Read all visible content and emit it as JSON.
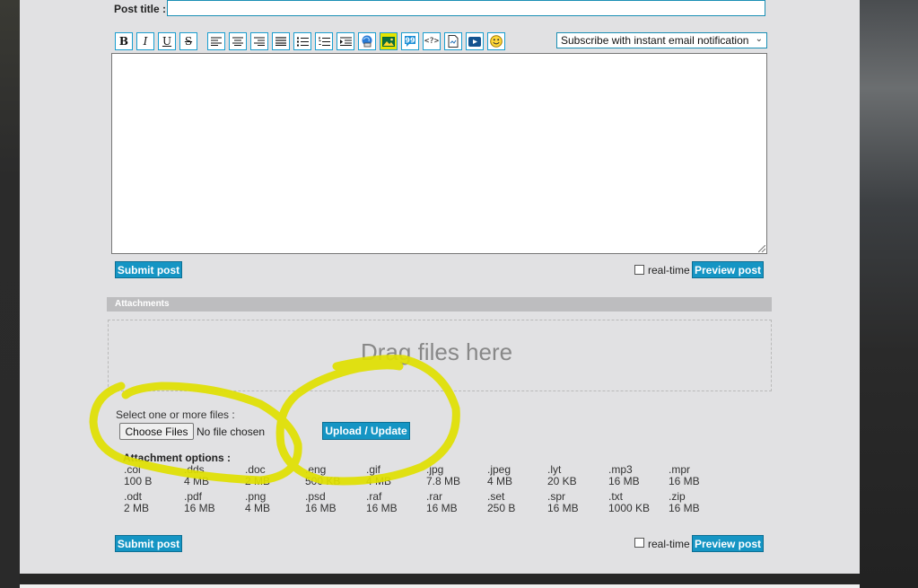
{
  "form": {
    "post_title_label": "Post title :",
    "post_title_value": ""
  },
  "toolbar": {
    "buttons": [
      {
        "name": "bold-icon",
        "glyph": "B"
      },
      {
        "name": "italic-icon",
        "glyph": "I"
      },
      {
        "name": "underline-icon",
        "glyph": "U"
      },
      {
        "name": "strikethrough-icon",
        "glyph": "S"
      },
      {
        "name": "align-left-icon"
      },
      {
        "name": "align-center-icon"
      },
      {
        "name": "align-right-icon"
      },
      {
        "name": "align-justify-icon"
      },
      {
        "name": "bulleted-list-icon"
      },
      {
        "name": "numbered-list-icon"
      },
      {
        "name": "indent-icon"
      },
      {
        "name": "insert-link-icon"
      },
      {
        "name": "insert-image-icon"
      },
      {
        "name": "quote-icon"
      },
      {
        "name": "code-icon",
        "glyph": "<?>"
      },
      {
        "name": "spoiler-icon"
      },
      {
        "name": "video-icon"
      },
      {
        "name": "smiley-icon"
      }
    ],
    "highlight_color": "#e4e400",
    "border_color": "#1a9ed0"
  },
  "subscribe": {
    "selected": "Subscribe with instant email notification"
  },
  "actions": {
    "submit_label": "Submit post",
    "realtime_label": "real-time",
    "preview_label": "Preview post",
    "accent": "#1595c4"
  },
  "attachments": {
    "header": "Attachments",
    "drag_text": "Drag files here",
    "select_label": "Select one or more files :",
    "choose_label": "Choose Files",
    "no_file_label": "No file chosen",
    "upload_label": "Upload / Update",
    "options_label": "Attachment options :",
    "options_row1": [
      {
        "ext": ".col",
        "size": "100 B"
      },
      {
        "ext": ".dds",
        "size": "4 MB"
      },
      {
        "ext": ".doc",
        "size": "2 MB"
      },
      {
        "ext": ".eng",
        "size": "500 KB"
      },
      {
        "ext": ".gif",
        "size": "4 MB"
      },
      {
        "ext": ".jpg",
        "size": "7.8 MB"
      },
      {
        "ext": ".jpeg",
        "size": "4 MB"
      },
      {
        "ext": ".lyt",
        "size": "20 KB"
      },
      {
        "ext": ".mp3",
        "size": "16 MB"
      },
      {
        "ext": ".mpr",
        "size": "16 MB"
      }
    ],
    "options_row2": [
      {
        "ext": ".odt",
        "size": "2 MB"
      },
      {
        "ext": ".pdf",
        "size": "16 MB"
      },
      {
        "ext": ".png",
        "size": "4 MB"
      },
      {
        "ext": ".psd",
        "size": "16 MB"
      },
      {
        "ext": ".raf",
        "size": "16 MB"
      },
      {
        "ext": ".rar",
        "size": "16 MB"
      },
      {
        "ext": ".set",
        "size": "250 B"
      },
      {
        "ext": ".spr",
        "size": "16 MB"
      },
      {
        "ext": ".txt",
        "size": "1000 KB"
      },
      {
        "ext": ".zip",
        "size": "16 MB"
      }
    ]
  },
  "annotation_color": "#e0e000"
}
